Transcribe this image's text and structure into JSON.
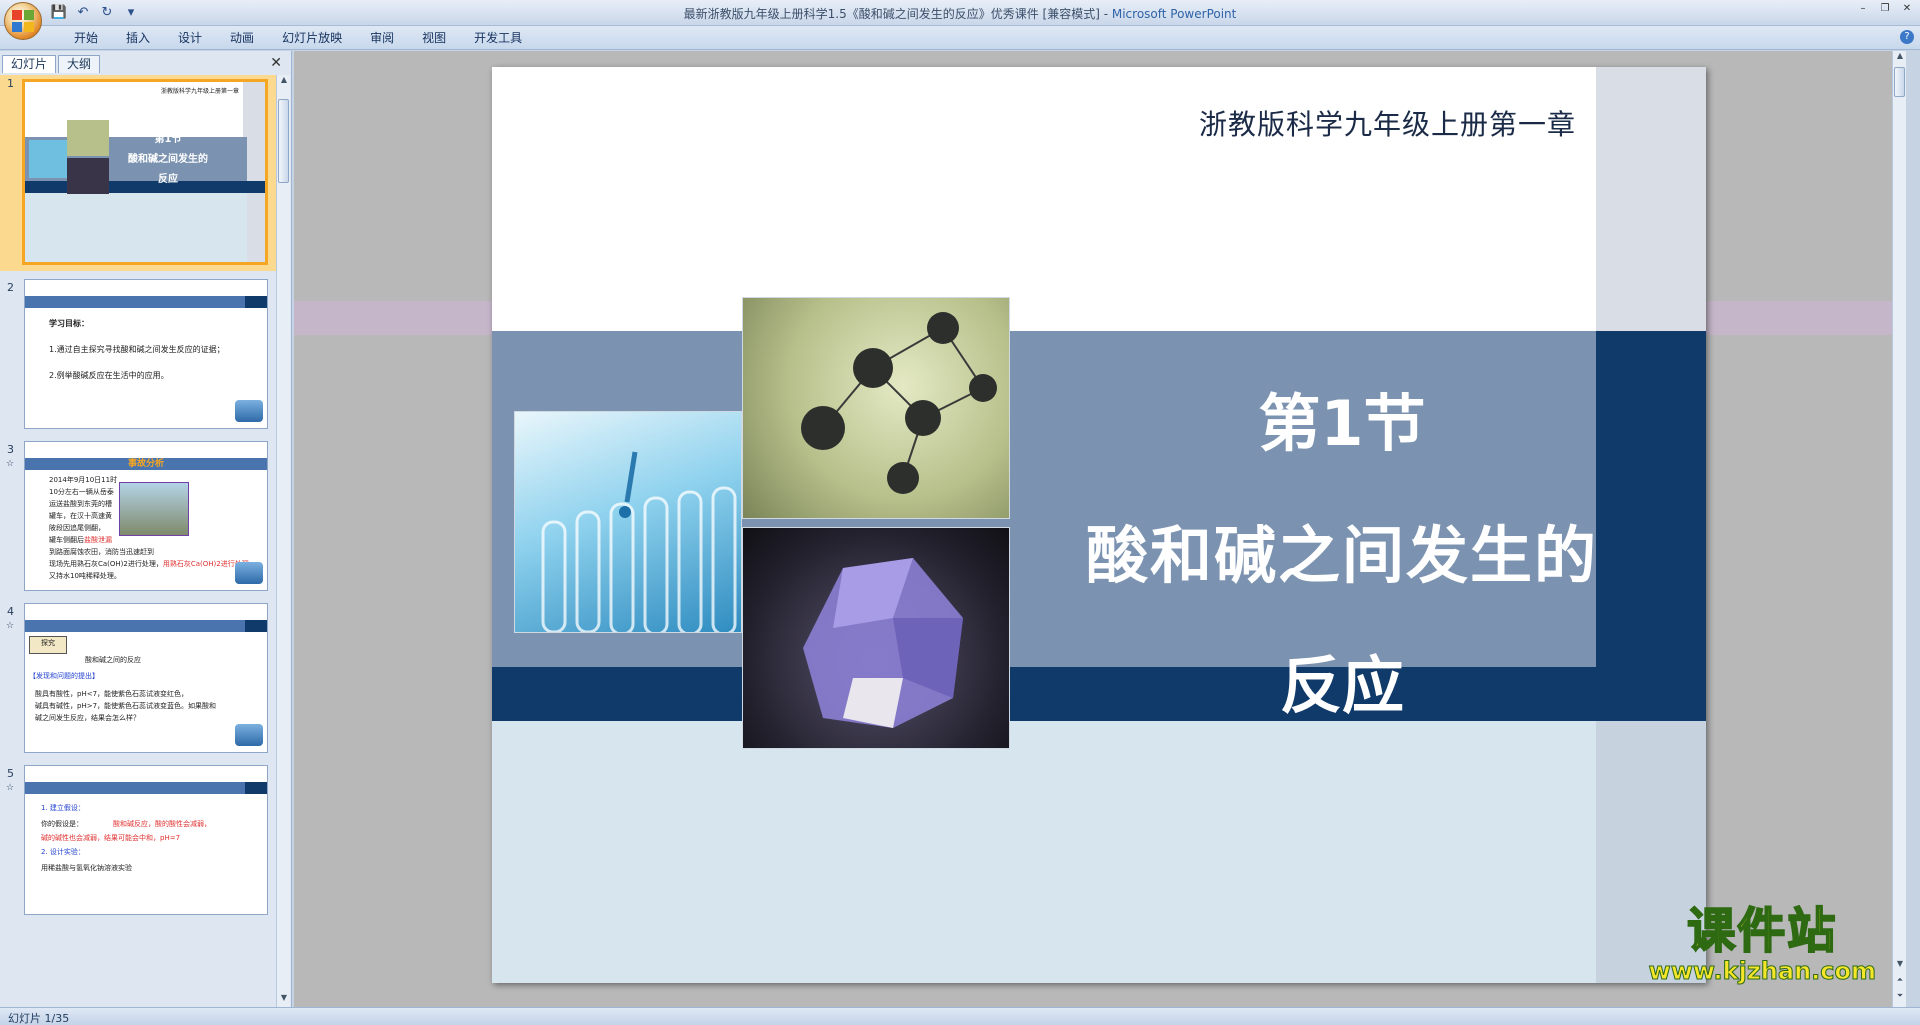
{
  "window": {
    "title_doc": "最新浙教版九年级上册科学1.5《酸和碱之间发生的反应》优秀课件 [兼容模式] - ",
    "title_app": "Microsoft PowerPoint"
  },
  "ribbon": {
    "tabs": [
      "开始",
      "插入",
      "设计",
      "动画",
      "幻灯片放映",
      "审阅",
      "视图",
      "开发工具"
    ]
  },
  "left_pane": {
    "tab_slides": "幻灯片",
    "tab_outline": "大纲",
    "thumbnails": [
      {
        "number": "1",
        "header": "浙教版科学九年级上册第一章",
        "title_1": "第1节",
        "title_2": "酸和碱之间发生的",
        "title_3": "反应"
      },
      {
        "number": "2",
        "lines": [
          "学习目标：",
          "1.通过自主探究寻找酸和碱之间发生反应的证据；",
          "2.例举酸碱反应在生活中的应用。"
        ]
      },
      {
        "number": "3",
        "star": "☆",
        "banner": "事故分析",
        "lines": [
          "2014年9月10日11时",
          "10分左右一辆从岳泰",
          "运送盐酸到东莞的槽",
          "罐车，在汉十高速黄",
          "陂段因追尾侧翻，",
          "罐车侧翻后",
          "到路面腐蚀农田，消防当迅速赶到",
          "现场先用熟石灰Ca(OH)2进行处理，",
          "又持水10吨稀释处理。"
        ],
        "red_1": "盐酸泄漏",
        "red_2": "用熟石灰Ca(OH)2进行处理"
      },
      {
        "number": "4",
        "star": "☆",
        "badge": "探究",
        "subtitle": "酸和碱之间的反应",
        "section": "【发现和问题的提出】",
        "lines": [
          "酸具有酸性，pH<7，能使紫色石蕊试液变红色，",
          "碱具有碱性，pH>7，能使紫色石蕊试液变蓝色。如果酸和",
          "碱之间发生反应，结果会怎么样？"
        ],
        "red": "红",
        "blue": "蓝"
      },
      {
        "number": "5",
        "star": "☆",
        "lines": [
          "1. 建立假设：",
          "你的假设是：",
          "酸和碱反应，酸的酸性会减弱，",
          "碱的碱性也会减弱，结果可能会中和，pH=7",
          "2. 设计实验：",
          "用稀盐酸与氢氧化钠溶液实验"
        ]
      }
    ]
  },
  "slide": {
    "header": "浙教版科学九年级上册第一章",
    "title_1": "第1节",
    "title_2": "酸和碱之间发生的",
    "title_3": "反应"
  },
  "watermark": {
    "cn": "课件站",
    "url": "www.kjzhan.com"
  },
  "status": {
    "slide_info": "幻灯片 1/35"
  },
  "colors": {
    "band_dark": "#0f3a6a",
    "band_mid": "#7b93b0",
    "selection": "#f5a623"
  }
}
